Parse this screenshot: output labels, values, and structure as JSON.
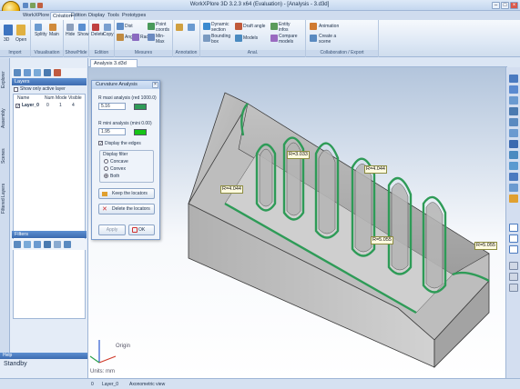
{
  "window": {
    "title": "WorkXPlore 3D 3.2.3 x64 (Evaluation) - [Analysis - 3.d3d]"
  },
  "tabs": [
    "WorkXPlore 3D",
    "Création",
    "Edition",
    "Display",
    "Tools",
    "Prototypes"
  ],
  "ribbon": {
    "groups": [
      {
        "label": "Import",
        "items": [
          "3D",
          "Open"
        ]
      },
      {
        "label": "Visualisation",
        "items": [
          "Splitty",
          "Main"
        ]
      },
      {
        "label": "Show/Hide",
        "items": [
          "Hide",
          "Show"
        ]
      },
      {
        "label": "Edition",
        "items": [
          "Delete",
          "Copy"
        ]
      },
      {
        "label": "Mesures",
        "items": [
          "Dist",
          "Point coords",
          "Ang",
          "Rad",
          "Min-Max"
        ]
      },
      {
        "label": "Annotation",
        "items": [
          "Annotation",
          "Text"
        ]
      },
      {
        "label": "Anal.",
        "items": [
          "Dynamic section",
          "Bounding box",
          "Draft angle",
          "Models",
          "Entity infos",
          "Compare models"
        ]
      },
      {
        "label": "Collaboration / Export",
        "items": [
          "Animation",
          "Create a scene"
        ]
      }
    ]
  },
  "left_panel": {
    "vertical_tabs": [
      "Explorer",
      "Assembly",
      "Scenes",
      "Filtered Layers"
    ],
    "layers_header": "Layers",
    "show_only_active": "Show only active layer",
    "columns": [
      "Name",
      "Num",
      "Mode",
      "Visible"
    ],
    "rows": [
      {
        "name": "Layer_0",
        "num": "0",
        "mode": "1",
        "visible": "4"
      }
    ],
    "filters_header": "Filters",
    "help_header": "Help",
    "help_text": "Standby"
  },
  "view_tab": "Analysis 3.d3d",
  "dialog": {
    "title": "Curvature Analysis",
    "rmax_label": "R maxi analysis  (red 1000.0)",
    "rmax_value": "5.16",
    "rmax_color": "#2e9b57",
    "rmin_label": "R mini analysis  (mini 0.00)",
    "rmin_value": "1.95",
    "rmin_color": "#17c417",
    "display_edges": "Display the edges",
    "display_filter": "Display filter",
    "filter_options": [
      "Concave",
      "Convex",
      "Both"
    ],
    "filter_selected": "Both",
    "keep_label": "Keep the locators",
    "delete_label": "Delete the locators",
    "apply_label": "Apply",
    "ok_label": "OK"
  },
  "annotations": [
    "R=3.033",
    "R=4.044",
    "R=4.044",
    "R=5.055",
    "R=5.055"
  ],
  "axis_label": "Origin",
  "units_label": "Units: mm",
  "status": {
    "layer_num": "0",
    "layer": "Layer_0",
    "view": "Axonometric view"
  },
  "colors": {
    "green_edge": "#2e9b57",
    "ribbon": "#dbe6f4",
    "header": "#4a7cc0"
  }
}
